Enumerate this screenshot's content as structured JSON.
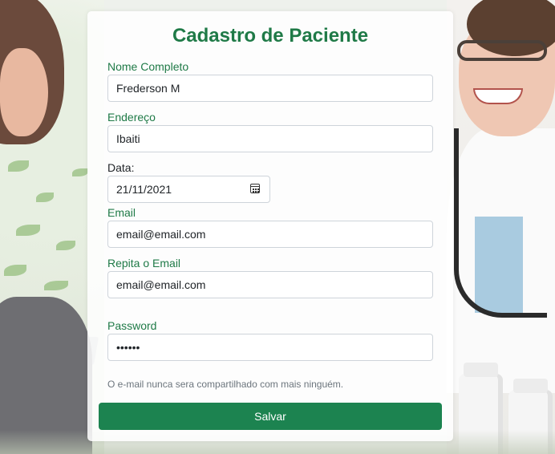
{
  "form": {
    "title": "Cadastro de Paciente",
    "fields": {
      "nome": {
        "label": "Nome Completo",
        "value": "Frederson M"
      },
      "endereco": {
        "label": "Endereço",
        "value": "Ibaiti"
      },
      "data": {
        "label": "Data:",
        "value": "21/11/2021"
      },
      "email": {
        "label": "Email",
        "value": "email@email.com"
      },
      "repita_email": {
        "label": "Repita o Email",
        "value": "email@email.com"
      },
      "password": {
        "label": "Password",
        "value": "••••••"
      }
    },
    "help_text": "O e-mail nunca sera compartilhado com mais ninguém.",
    "submit_label": "Salvar"
  },
  "colors": {
    "accent": "#1f7a47",
    "button": "#1c8350"
  }
}
